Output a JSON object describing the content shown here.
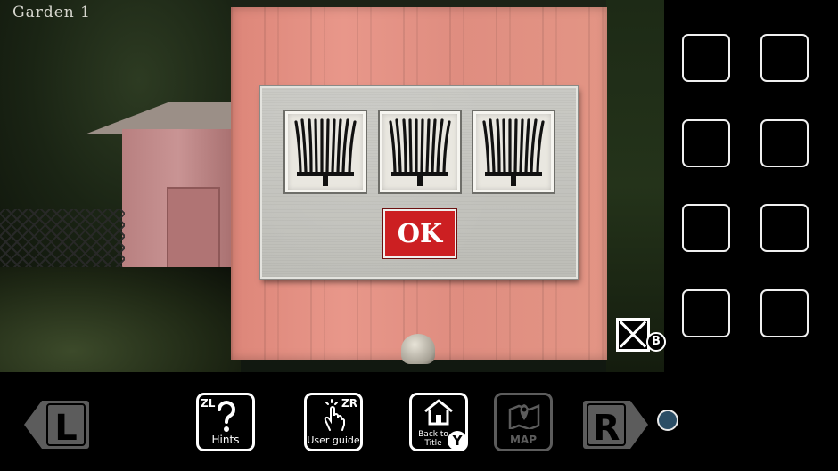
{
  "scene": {
    "title": "Garden 1"
  },
  "puzzle": {
    "slots": [
      {
        "icon": "rake-icon"
      },
      {
        "icon": "rake-icon"
      },
      {
        "icon": "rake-icon"
      }
    ],
    "ok_label": "OK"
  },
  "inventory": {
    "slot_count": 8,
    "close_badge": "B"
  },
  "toolbar": {
    "left_label": "L",
    "right_label": "R",
    "hints": {
      "corner": "ZL",
      "label": "Hints"
    },
    "user_guide": {
      "corner": "ZR",
      "label": "User guide"
    },
    "back_to_title": {
      "label_line1": "Back to",
      "label_line2": "Title",
      "badge": "Y"
    },
    "map": {
      "label": "MAP"
    }
  },
  "colors": {
    "ok_button": "#cc1f22",
    "panel_wood": "#e39585",
    "page_dot": "#2b4e66",
    "disabled_gray": "#5c5c5c"
  }
}
